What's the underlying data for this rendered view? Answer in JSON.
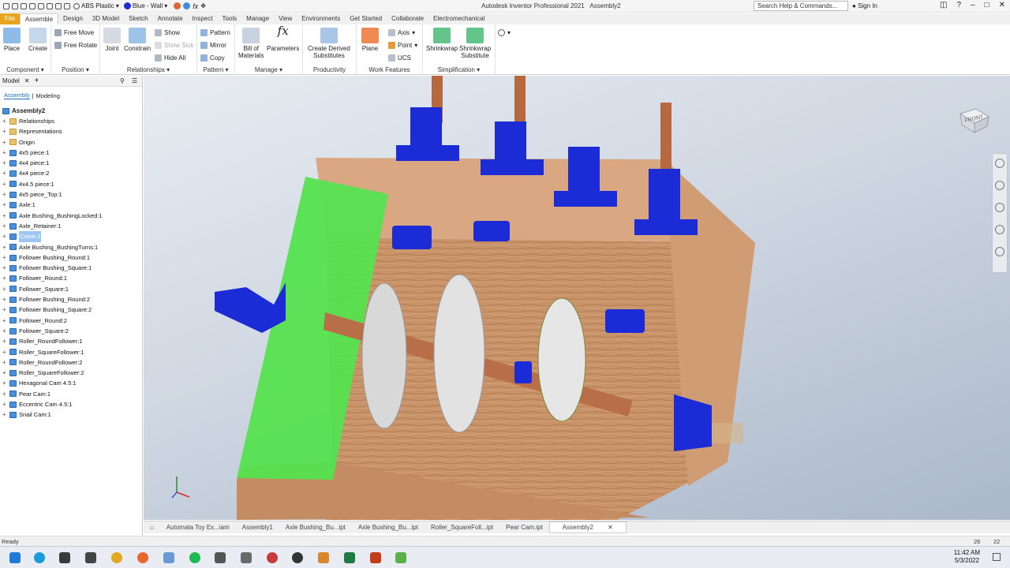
{
  "titlebar": {
    "material": "ABS Plastic",
    "appearance": "Blue - Wall",
    "app_title": "Autodesk Inventor Professional 2021",
    "doc_title": "Assembly2",
    "search_placeholder": "Search Help & Commands...",
    "sign_in": "Sign In"
  },
  "ribbon_tabs": [
    "File",
    "Assemble",
    "Design",
    "3D Model",
    "Sketch",
    "Annotate",
    "Inspect",
    "Tools",
    "Manage",
    "View",
    "Environments",
    "Get Started",
    "Collaborate",
    "Electromechanical"
  ],
  "ribbon": {
    "place": "Place",
    "create": "Create",
    "free_move": "Free Move",
    "free_rotate": "Free Rotate",
    "joint": "Joint",
    "constrain": "Constrain",
    "show": "Show",
    "show_sick": "Show Sick",
    "hide_all": "Hide All",
    "pattern": "Pattern",
    "mirror": "Mirror",
    "copy": "Copy",
    "bom_line1": "Bill of",
    "bom_line2": "Materials",
    "parameters": "Parameters",
    "cds_line1": "Create Derived",
    "cds_line2": "Substitutes",
    "plane": "Plane",
    "axis": "Axis",
    "point": "Point",
    "ucs": "UCS",
    "shrinkwrap": "Shrinkwrap",
    "sws_line1": "Shrinkwrap",
    "sws_line2": "Substitute",
    "panels": [
      "Component",
      "Position",
      "Relationships",
      "Pattern",
      "Manage",
      "Productivity",
      "Work Features",
      "Simplification"
    ]
  },
  "browser": {
    "tab_label": "Model",
    "sub_assembly": "Assembly",
    "sub_modeling": "Modeling",
    "root": "Assembly2",
    "items": [
      {
        "label": "Relationships",
        "type": "folder"
      },
      {
        "label": "Representations",
        "type": "folder"
      },
      {
        "label": "Origin",
        "type": "folder"
      },
      {
        "label": "4x5 piece:1",
        "type": "part"
      },
      {
        "label": "4x4 piece:1",
        "type": "part"
      },
      {
        "label": "4x4 piece:2",
        "type": "part"
      },
      {
        "label": "4x4.5 piece:1",
        "type": "part"
      },
      {
        "label": "4x5 piece_Top:1",
        "type": "part"
      },
      {
        "label": "Axle:1",
        "type": "part"
      },
      {
        "label": "Axle Bushing_BushingLocked:1",
        "type": "part"
      },
      {
        "label": "Axle_Retainer:1",
        "type": "part"
      },
      {
        "label": "Crank:1",
        "type": "part",
        "selected": true
      },
      {
        "label": "Axle Bushing_BushingTurns:1",
        "type": "part"
      },
      {
        "label": "Follower Bushing_Round:1",
        "type": "part"
      },
      {
        "label": "Follower Bushing_Square:1",
        "type": "part"
      },
      {
        "label": "Follower_Round:1",
        "type": "part"
      },
      {
        "label": "Follower_Square:1",
        "type": "part"
      },
      {
        "label": "Follower Bushing_Round:2",
        "type": "part"
      },
      {
        "label": "Follower Bushing_Square:2",
        "type": "part"
      },
      {
        "label": "Follower_Round:2",
        "type": "part"
      },
      {
        "label": "Follower_Square:2",
        "type": "part"
      },
      {
        "label": "Roller_RoundFollower:1",
        "type": "part"
      },
      {
        "label": "Roller_SquareFollower:1",
        "type": "part"
      },
      {
        "label": "Roller_RoundFollower:2",
        "type": "part"
      },
      {
        "label": "Roller_SquareFollower:2",
        "type": "part"
      },
      {
        "label": "Hexagonal Cam 4.5:1",
        "type": "part"
      },
      {
        "label": "Pear Cam:1",
        "type": "part"
      },
      {
        "label": "Eccentric Cam 4.5:1",
        "type": "part"
      },
      {
        "label": "Snail Cam:1",
        "type": "part"
      }
    ]
  },
  "viewcube_label": "FRONT",
  "doc_tabs": [
    "Automata Toy Ex...iam",
    "Assembly1",
    "Axle Bushing_Bu...ipt",
    "Axle Bushing_Bu...ipt",
    "Roller_SquareFoll...ipt",
    "Pear Cam.ipt",
    "Assembly2"
  ],
  "active_doc_tab": "Assembly2",
  "status": {
    "text": "Ready",
    "num1": "26",
    "num2": "22"
  },
  "taskbar": {
    "time": "11:42 AM",
    "date": "5/3/2022"
  },
  "colors": {
    "file_tab": "#e8a31f",
    "selection": "#9dc6f2",
    "blue_part": "#1b2bd6",
    "wood": "#c9936a",
    "green_face": "#55e24f"
  }
}
